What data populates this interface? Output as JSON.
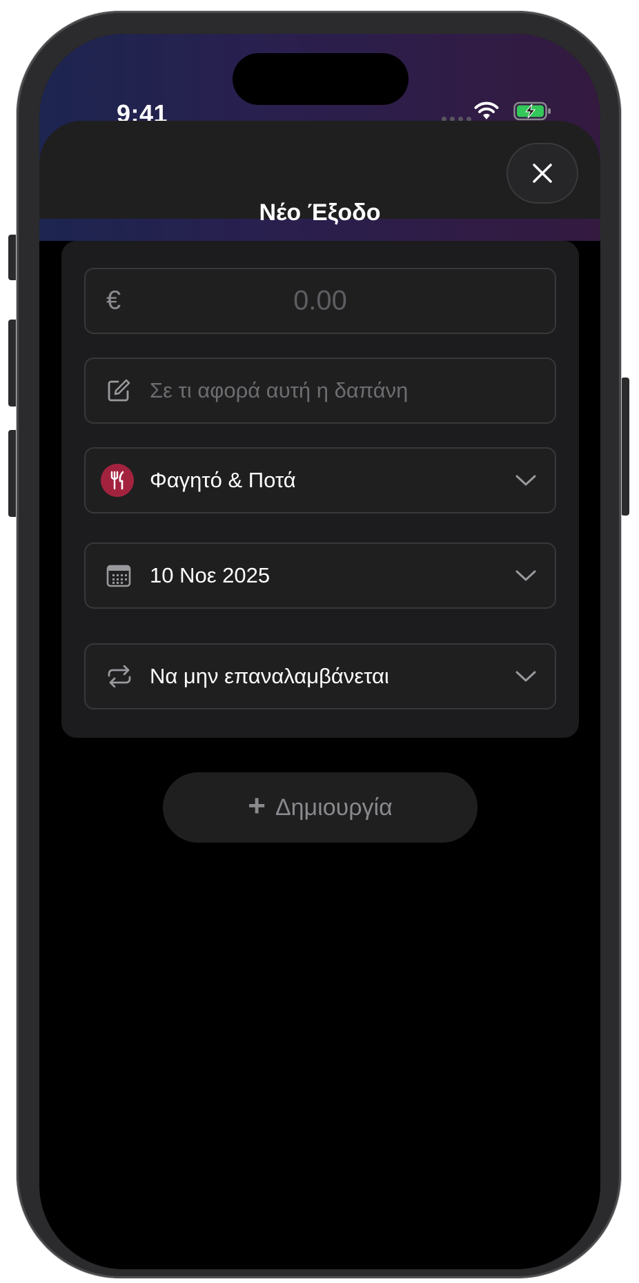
{
  "status_bar": {
    "time": "9:41"
  },
  "sheet": {
    "title": "Νέο Έξοδο",
    "close_icon": "xmark-icon"
  },
  "form": {
    "amount": {
      "currency_symbol": "€",
      "placeholder": "0.00"
    },
    "description": {
      "icon": "square-pencil-icon",
      "placeholder": "Σε τι αφορά αυτή η δαπάνη"
    },
    "category": {
      "icon": "fork-knife-icon",
      "icon_color": "#a3233f",
      "value": "Φαγητό & Ποτά"
    },
    "date": {
      "icon": "calendar-icon",
      "value": "10 Νοε 2025"
    },
    "repeat": {
      "icon": "repeat-icon",
      "value": "Να μην επαναλαμβάνεται"
    }
  },
  "actions": {
    "create_label": "Δημιουργία",
    "create_icon": "plus-icon"
  },
  "colors": {
    "background": "#000000",
    "card": "#1c1c1e",
    "accent_category": "#a3233f",
    "battery": "#34c759"
  }
}
